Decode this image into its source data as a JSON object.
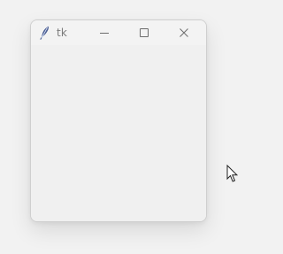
{
  "window": {
    "title": "tk"
  },
  "icons": {
    "app": "feather-icon",
    "minimize": "minimize-icon",
    "maximize": "maximize-icon",
    "close": "close-icon",
    "cursor": "mouse-pointer-icon"
  },
  "colors": {
    "desktop": "#f2f2f2",
    "window": "#f0f0f0",
    "titlebar": "#f3f3f3",
    "title_text": "#7a7a7a",
    "icon": "#4b5e92"
  }
}
